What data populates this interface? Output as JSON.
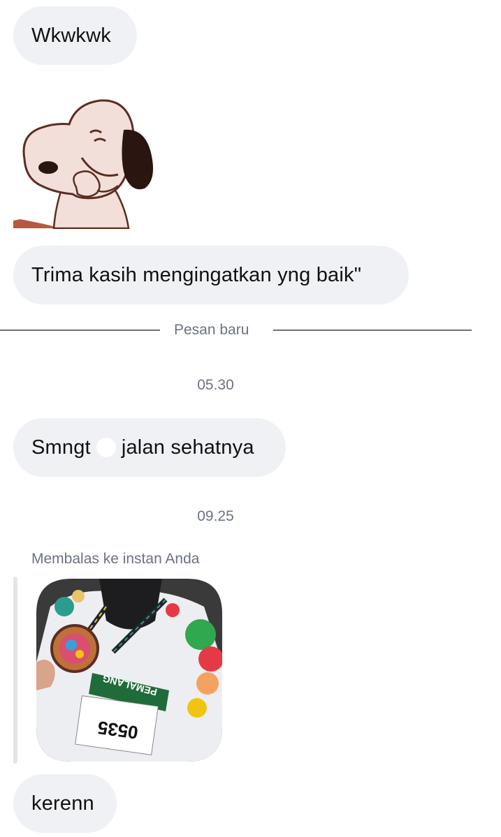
{
  "messages": {
    "m1": "Wkwkwk",
    "m2": "Trima kasih mengingatkan yng baik\"",
    "m3_part1": "Smngt",
    "m3_part2": "jalan sehatnya",
    "m4": "kerenn"
  },
  "divider": {
    "label": "Pesan baru"
  },
  "timestamps": {
    "t1": "05.30",
    "t2": "09.25"
  },
  "reply": {
    "label": "Membalas ke instan Anda"
  },
  "image_content": {
    "bib_number": "0535",
    "lanyard_text": "PEMALANG"
  },
  "icons": {
    "sticker": "snoopy-laughing-sticker",
    "emoji": "emoji-icon"
  },
  "colors": {
    "bubble_bg": "#eff1f4",
    "meta_text": "#6b7280",
    "divider_line": "#6b7280",
    "reply_bar": "#e3e5e9"
  }
}
